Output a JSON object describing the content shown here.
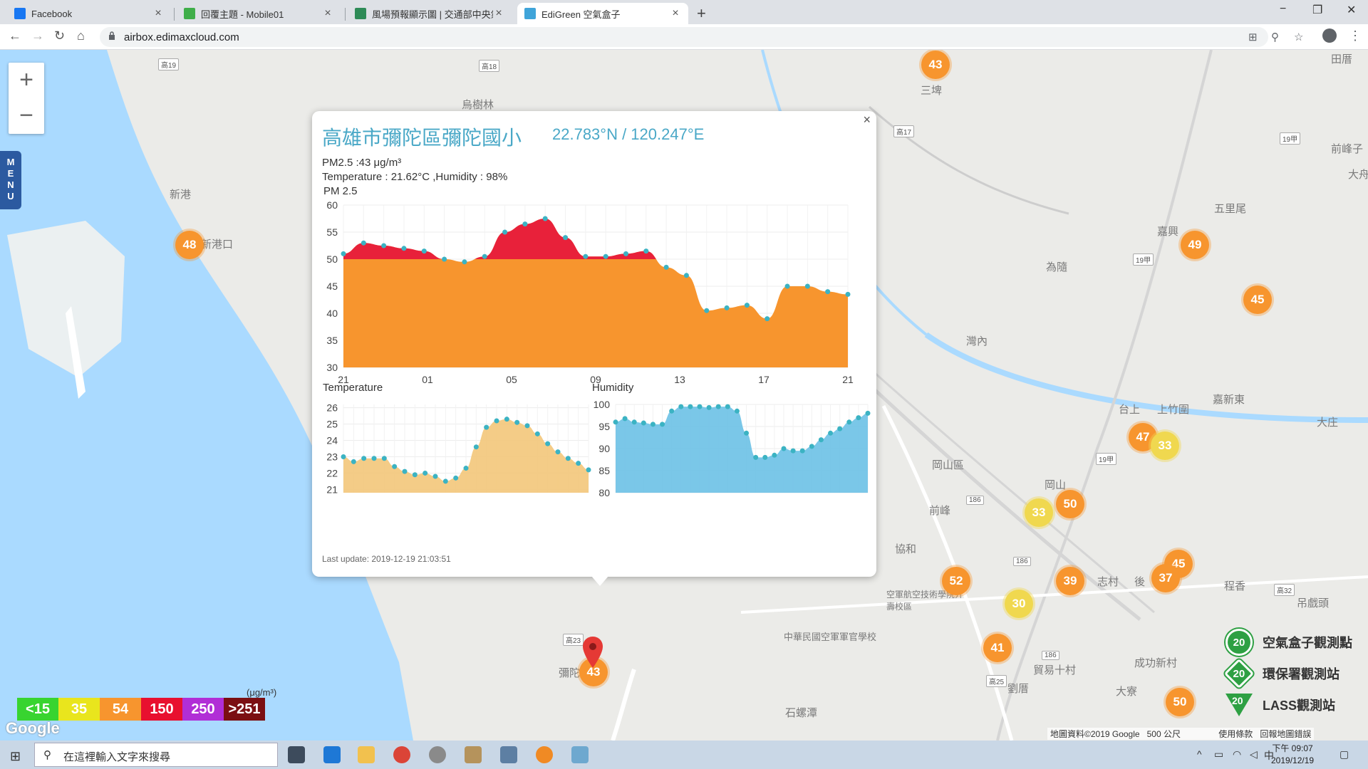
{
  "browser": {
    "tabs": [
      {
        "title": "Facebook",
        "favicon_color": "#1877f2"
      },
      {
        "title": "回覆主題 - Mobile01",
        "favicon_color": "#3fae49"
      },
      {
        "title": "風場預報顯示圖 | 交通部中央氣象",
        "favicon_color": "#2e8b57"
      },
      {
        "title": "EdiGreen 空氣盒子",
        "favicon_color": "#3fa4d9"
      }
    ],
    "url": "airbox.edimaxcloud.com"
  },
  "map": {
    "labels": [
      {
        "text": "烏樹林"
      },
      {
        "text": "新港"
      },
      {
        "text": "新港口"
      },
      {
        "text": "三埤"
      },
      {
        "text": "五里尾"
      },
      {
        "text": "嘉興"
      },
      {
        "text": "為隨"
      },
      {
        "text": "灣內"
      },
      {
        "text": "台上"
      },
      {
        "text": "上竹圍"
      },
      {
        "text": "嘉新東"
      },
      {
        "text": "大庄"
      },
      {
        "text": "岡山區"
      },
      {
        "text": "岡山"
      },
      {
        "text": "前峰"
      },
      {
        "text": "協和"
      },
      {
        "text": "志村"
      },
      {
        "text": "程香"
      },
      {
        "text": "吊戲頭"
      },
      {
        "text": "後"
      },
      {
        "text": "成功新村"
      },
      {
        "text": "貿易十村"
      },
      {
        "text": "劉厝"
      },
      {
        "text": "大寮"
      },
      {
        "text": "石螺潭"
      },
      {
        "text": "彌陀"
      },
      {
        "text": "田厝"
      },
      {
        "text": "前峰子"
      },
      {
        "text": "大舟"
      },
      {
        "text": "中華民國空軍軍官學校"
      },
      {
        "text": "空軍航空技術學院介壽校區"
      }
    ],
    "road_shields": [
      "高19",
      "高18",
      "高17",
      "19甲",
      "186",
      "186",
      "186",
      "高23",
      "高25",
      "高32",
      "19甲",
      "19甲"
    ],
    "markers": [
      {
        "value": "43",
        "color": "orange"
      },
      {
        "value": "48",
        "color": "orange"
      },
      {
        "value": "49",
        "color": "orange"
      },
      {
        "value": "45",
        "color": "orange"
      },
      {
        "value": "47",
        "color": "orange"
      },
      {
        "value": "33",
        "color": "yellow"
      },
      {
        "value": "50",
        "color": "orange"
      },
      {
        "value": "33",
        "color": "yellow"
      },
      {
        "value": "52",
        "color": "orange"
      },
      {
        "value": "39",
        "color": "orange"
      },
      {
        "value": "30",
        "color": "yellow"
      },
      {
        "value": "45",
        "color": "orange"
      },
      {
        "value": "37",
        "color": "orange"
      },
      {
        "value": "41",
        "color": "orange"
      },
      {
        "value": "50",
        "color": "orange"
      },
      {
        "value": "43",
        "color": "orange"
      }
    ],
    "zoom_in": "+",
    "zoom_out": "−",
    "menu_label": "MENU",
    "attribution": "地圖資料©2019 Google",
    "scale": "500 公尺",
    "terms": "使用條款",
    "report": "回報地圖錯誤",
    "google": "Google"
  },
  "popup": {
    "title": "高雄市彌陀區彌陀國小",
    "coords": "22.783°N / 120.247°E",
    "pm25_line": "PM2.5 :43 μg/m³",
    "temp_line": "Temperature : 21.62°C ,Humidity : 98%",
    "pm_chart_title": "PM 2.5",
    "temp_chart_title": "Temperature",
    "hum_chart_title": "Humidity",
    "last_update": "Last update: 2019-12-19 21:03:51",
    "close": "×"
  },
  "chart_data": [
    {
      "type": "area",
      "title": "PM 2.5",
      "x_ticks": [
        "21",
        "01",
        "05",
        "09",
        "13",
        "17",
        "21"
      ],
      "y_ticks": [
        "60",
        "55",
        "50",
        "45",
        "40",
        "35",
        "30"
      ],
      "ylim": [
        30,
        60
      ],
      "threshold": 50,
      "values": [
        51,
        53,
        52.5,
        52,
        51.5,
        50,
        49.5,
        50.5,
        55,
        56.5,
        57.5,
        54,
        50.5,
        50.5,
        51,
        51.5,
        48.5,
        47,
        40.5,
        41,
        41.5,
        39,
        45,
        45,
        44,
        43.5
      ],
      "colors": {
        "above": "#e8213a",
        "below": "#f7952e",
        "points": "#3bb3c3"
      }
    },
    {
      "type": "area",
      "title": "Temperature",
      "y_ticks": [
        "26",
        "25",
        "24",
        "23",
        "22",
        "21"
      ],
      "ylim": [
        20.8,
        26.2
      ],
      "values": [
        23,
        22.7,
        22.9,
        22.9,
        22.9,
        22.4,
        22.1,
        21.9,
        22,
        21.8,
        21.5,
        21.7,
        22.3,
        23.6,
        24.8,
        25.2,
        25.3,
        25.1,
        24.9,
        24.4,
        23.8,
        23.3,
        22.9,
        22.6,
        22.2
      ],
      "colors": {
        "fill": "#f3c77a",
        "points": "#3bb3c3"
      }
    },
    {
      "type": "area",
      "title": "Humidity",
      "y_ticks": [
        "100",
        "95",
        "90",
        "85",
        "80"
      ],
      "ylim": [
        80,
        100
      ],
      "values": [
        96,
        96.8,
        96,
        95.8,
        95.5,
        95.5,
        98.5,
        99.5,
        99.5,
        99.5,
        99.3,
        99.5,
        99.5,
        98.5,
        93.5,
        88,
        88,
        88.5,
        90,
        89.5,
        89.5,
        90.5,
        92,
        93.5,
        94.5,
        96,
        97,
        98
      ],
      "colors": {
        "fill": "#6cc1e6",
        "points": "#3bb3c3"
      }
    }
  ],
  "legend": {
    "items": [
      {
        "icon_text": "20",
        "label": "空氣盒子觀測點"
      },
      {
        "icon_text": "20",
        "label": "環保署觀測站"
      },
      {
        "icon_text": "20",
        "label": "LASS觀測站"
      }
    ]
  },
  "pm_scale": {
    "unit": "(μg/m³)",
    "levels": [
      {
        "label": "<15",
        "color": "#38d430"
      },
      {
        "label": "35",
        "color": "#e9e51d"
      },
      {
        "label": "54",
        "color": "#f7952e"
      },
      {
        "label": "150",
        "color": "#e8102f"
      },
      {
        "label": "250",
        "color": "#b12ed6"
      },
      {
        "label": ">251",
        "color": "#7b0f12"
      }
    ]
  },
  "taskbar": {
    "search_placeholder": "在這裡輸入文字來搜尋",
    "time": "下午 09:07",
    "date": "2019/12/19",
    "ime": "中"
  }
}
